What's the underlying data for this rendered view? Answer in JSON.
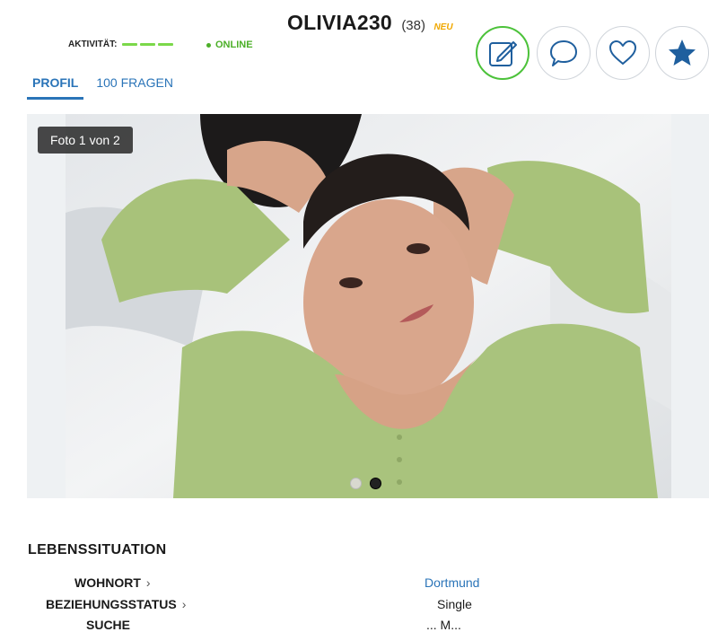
{
  "header": {
    "username": "OLIVIA230",
    "age": "(38)",
    "new_badge": "NEU",
    "activity_label": "AKTIVITÄT:",
    "activity_level": 3,
    "status": "ONLINE"
  },
  "tabs": [
    {
      "label": "PROFIL",
      "active": true
    },
    {
      "label": "100 FRAGEN",
      "active": false
    }
  ],
  "actions": [
    {
      "name": "edit-note",
      "icon": "edit-icon"
    },
    {
      "name": "message",
      "icon": "chat-bubble-icon"
    },
    {
      "name": "like",
      "icon": "heart-icon"
    },
    {
      "name": "favorite",
      "icon": "star-icon"
    }
  ],
  "photo": {
    "counter": "Foto 1 von 2",
    "current": 1,
    "total": 2
  },
  "lebenssituation": {
    "title": "LEBENSSITUATION",
    "rows": [
      {
        "label": "WOHNORT",
        "value": "Dortmund",
        "link": true
      },
      {
        "label": "BEZIEHUNGSSTATUS",
        "value": "Single",
        "link": false
      },
      {
        "label": "SUCHE",
        "value": "... M...",
        "link": false
      }
    ]
  },
  "colors": {
    "accent": "#2a74b8",
    "online": "#4caf28",
    "activity_bar": "#7bd84a",
    "new_badge": "#f0a800",
    "active_circle": "#4cc23a"
  }
}
